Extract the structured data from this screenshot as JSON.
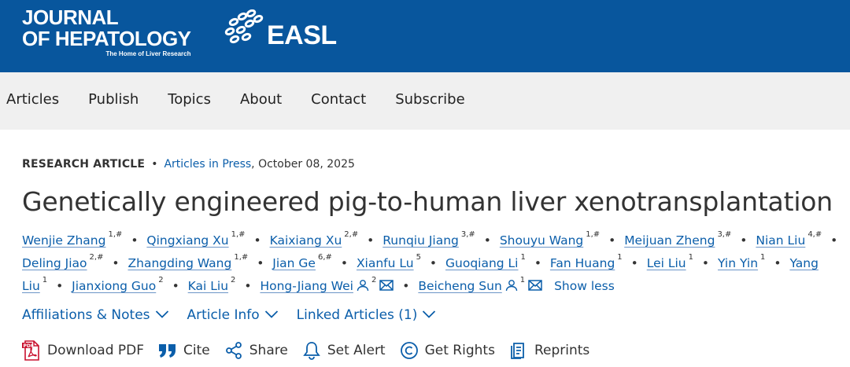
{
  "header": {
    "journal_line1": "JOURNAL",
    "journal_line2": "OF HEPATOLOGY",
    "journal_tagline": "The Home of Liver Research",
    "society": "EASL",
    "band_color": "#08569d"
  },
  "nav": {
    "items": [
      {
        "label": "Articles"
      },
      {
        "label": "Publish"
      },
      {
        "label": "Topics"
      },
      {
        "label": "About"
      },
      {
        "label": "Contact"
      },
      {
        "label": "Subscribe"
      }
    ]
  },
  "article": {
    "type": "RESEARCH ARTICLE",
    "bullet": "•",
    "collection": "Articles in Press",
    "date": ", October 08, 2025",
    "title": "Genetically engineered pig-to-human liver xenotransplantation"
  },
  "authors": [
    {
      "name": "Wenjie Zhang",
      "sup": "1,#"
    },
    {
      "name": "Qingxiang Xu",
      "sup": "1,#"
    },
    {
      "name": "Kaixiang Xu",
      "sup": "2,#"
    },
    {
      "name": "Runqiu Jiang",
      "sup": "3,#"
    },
    {
      "name": "Shouyu Wang",
      "sup": "1,#"
    },
    {
      "name": "Meijuan Zheng",
      "sup": "3,#"
    },
    {
      "name": "Nian Liu",
      "sup": "4,#"
    },
    {
      "name": "Deling Jiao",
      "sup": "2,#"
    },
    {
      "name": "Zhangding Wang",
      "sup": "1,#"
    },
    {
      "name": "Jian Ge",
      "sup": "6,#"
    },
    {
      "name": "Xianfu Lu",
      "sup": "5"
    },
    {
      "name": "Guoqiang Li",
      "sup": "1"
    },
    {
      "name": "Fan Huang",
      "sup": "1"
    },
    {
      "name": "Lei Liu",
      "sup": "1"
    },
    {
      "name": "Yin Yin",
      "sup": "1"
    },
    {
      "name": "Yang Liu",
      "sup": "1"
    },
    {
      "name": "Jianxiong Guo",
      "sup": "2"
    },
    {
      "name": "Kai Liu",
      "sup": "2"
    },
    {
      "name": "Hong-Jiang Wei",
      "sup": "2",
      "icons": [
        "person-icon",
        "mail-icon"
      ]
    },
    {
      "name": "Beicheng Sun",
      "sup": "1",
      "icons": [
        "person-icon",
        "mail-icon"
      ]
    }
  ],
  "show_less": "Show less",
  "accordions": [
    {
      "label": "Affiliations & Notes",
      "icon": "chevron-down-icon"
    },
    {
      "label": "Article Info",
      "icon": "chevron-down-icon"
    },
    {
      "label": "Linked Articles (1)",
      "icon": "chevron-down-icon"
    }
  ],
  "actions": [
    {
      "label": "Download PDF",
      "icon": "pdf-icon"
    },
    {
      "label": "Cite",
      "icon": "quote-icon"
    },
    {
      "label": "Share",
      "icon": "share-icon"
    },
    {
      "label": "Set Alert",
      "icon": "bell-icon"
    },
    {
      "label": "Get Rights",
      "icon": "copyright-icon"
    },
    {
      "label": "Reprints",
      "icon": "reprints-icon"
    }
  ],
  "colors": {
    "link": "#0b5eaa",
    "text": "#333333",
    "nav_bg": "#f0f0f0",
    "pdf_red": "#c8102e"
  }
}
